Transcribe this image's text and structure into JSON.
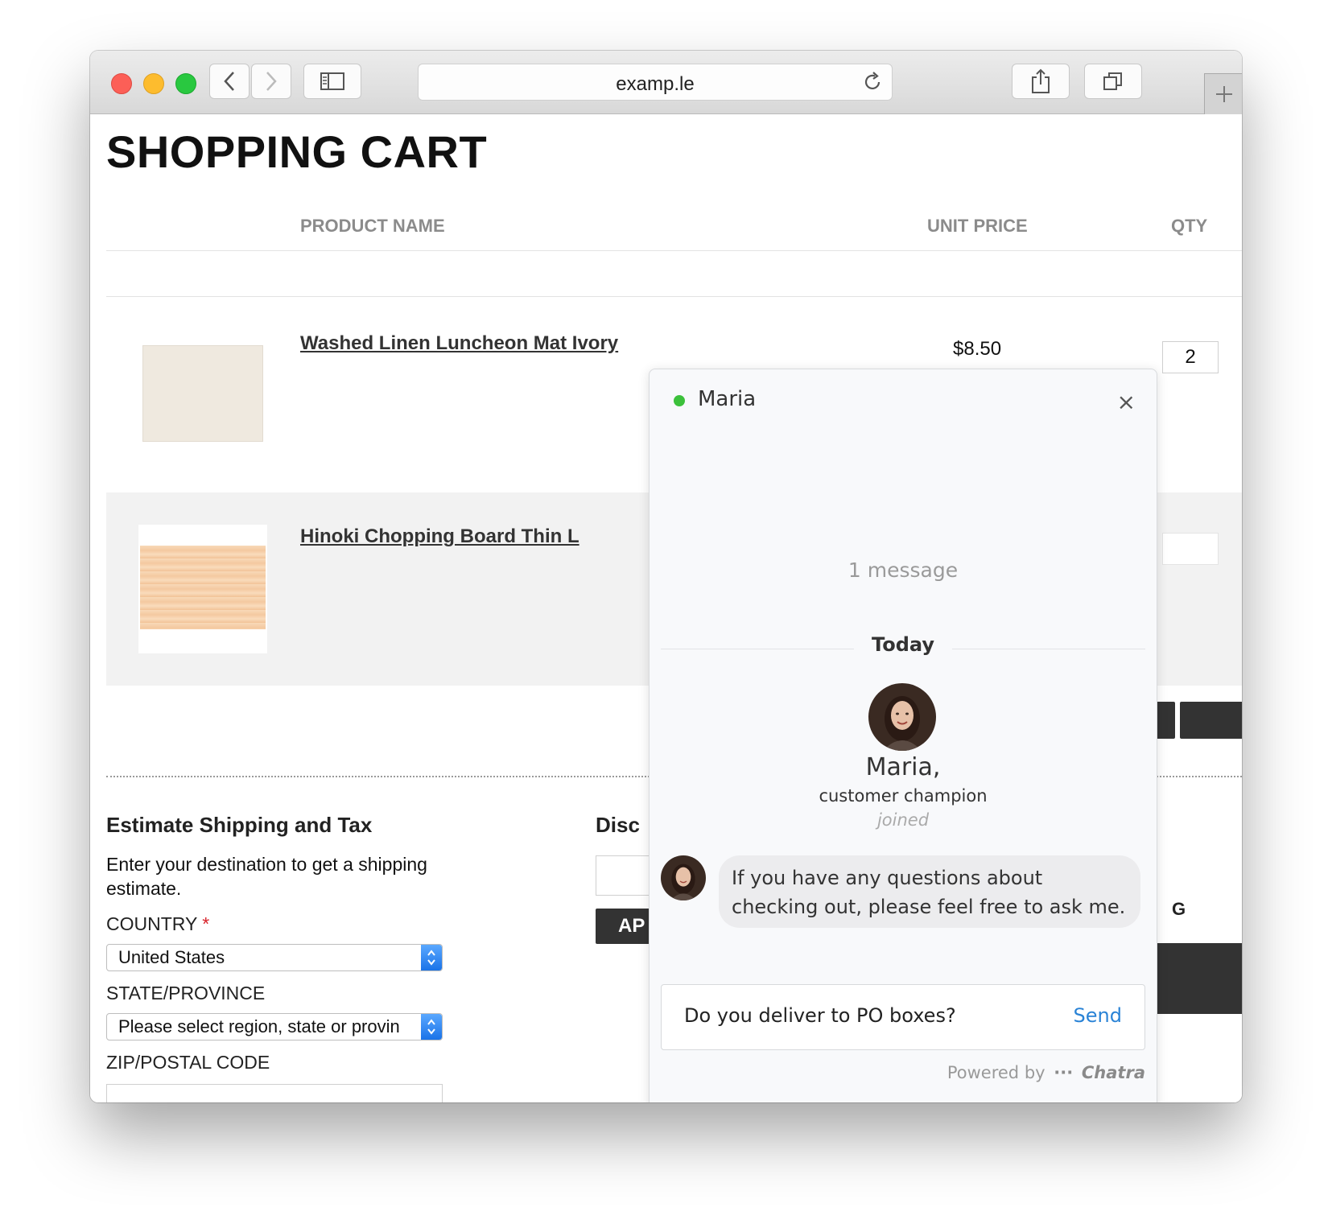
{
  "browser": {
    "url": "examp.le"
  },
  "page": {
    "title": "SHOPPING CART",
    "columns": {
      "product": "PRODUCT NAME",
      "unit_price": "UNIT PRICE",
      "qty": "QTY"
    },
    "items": [
      {
        "name": "Washed Linen Luncheon Mat Ivory",
        "price": "$8.50",
        "qty": "2"
      },
      {
        "name": "Hinoki Chopping Board Thin L",
        "price": "",
        "qty": ""
      }
    ],
    "shipping": {
      "heading": "Estimate Shipping and Tax",
      "description": "Enter your destination to get a shipping estimate.",
      "country_label": "COUNTRY",
      "required_mark": "*",
      "country_value": "United States",
      "state_label": "STATE/PROVINCE",
      "state_value": "Please select region, state or provin",
      "zip_label": "ZIP/POSTAL CODE",
      "zip_value": ""
    },
    "discount": {
      "heading_partial": "Disc",
      "apply_partial": "AP"
    },
    "right_edge_partial": "G"
  },
  "chat": {
    "agent_name": "Maria",
    "status": "online",
    "close_label": "×",
    "message_count": "1 message",
    "day_label": "Today",
    "join_name": "Maria,",
    "join_role": "customer champion",
    "join_status": "joined",
    "message": "If you have any questions about checking out, please feel free to ask me.",
    "input_value": "Do you deliver to PO boxes?",
    "send_label": "Send",
    "powered_by": "Powered by",
    "brand": "Chatra",
    "accent_color": "#2a83d6",
    "online_color": "#3cc13b"
  }
}
